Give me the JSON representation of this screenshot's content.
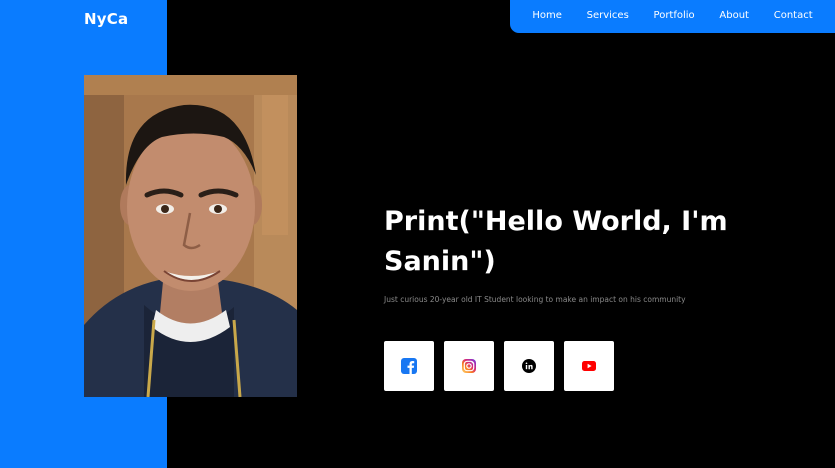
{
  "brand": {
    "name": "NyCa"
  },
  "nav": {
    "items": [
      {
        "label": "Home"
      },
      {
        "label": "Services"
      },
      {
        "label": "Portfolio"
      },
      {
        "label": "About"
      },
      {
        "label": "Contact"
      }
    ]
  },
  "hero": {
    "headline": "Print(\"Hello World, I'm Sanin\")",
    "subtitle": "Just curious 20-year old IT Student looking to make an impact on his community"
  },
  "socials": [
    {
      "icon": "facebook-icon",
      "color": "#1877f2"
    },
    {
      "icon": "instagram-icon",
      "color": "#e1306c"
    },
    {
      "icon": "linkedin-icon",
      "color": "#000000"
    },
    {
      "icon": "youtube-icon",
      "color": "#ff0000"
    }
  ],
  "colors": {
    "accent": "#0a7cff",
    "background": "#000000",
    "text": "#ffffff",
    "muted": "#8a8a8a"
  }
}
